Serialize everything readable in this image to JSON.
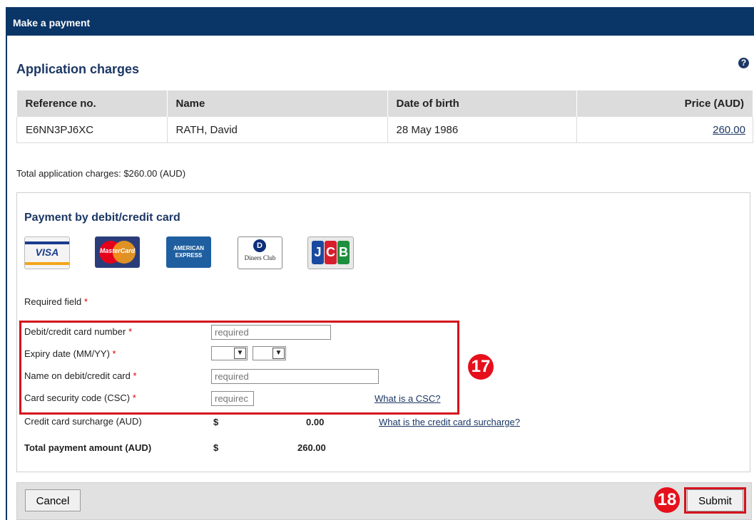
{
  "header": {
    "title": "Make a payment"
  },
  "charges": {
    "title": "Application charges",
    "help_icon": "?",
    "columns": [
      "Reference no.",
      "Name",
      "Date of birth",
      "Price (AUD)"
    ],
    "rows": [
      {
        "reference": "E6NN3PJ6XC",
        "name": "RATH, David",
        "dob": "28 May 1986",
        "price": "260.00"
      }
    ],
    "total_text": "Total application charges: $260.00 (AUD)"
  },
  "payment": {
    "title": "Payment by debit/credit card",
    "cards": {
      "visa": "VISA",
      "mastercard": "MasterCard",
      "amex_line1": "AMERICAN",
      "amex_line2": "EXPRESS",
      "diners": "Diners Club",
      "diners_letter": "D",
      "jcb": [
        "J",
        "C",
        "B"
      ]
    },
    "required_note": "Required field",
    "required_star": "*",
    "fields": {
      "card_number_label": "Debit/credit card number",
      "card_number_placeholder": "required",
      "expiry_label": "Expiry date (MM/YY)",
      "expiry_month": "",
      "expiry_year": "",
      "name_label": "Name on debit/credit card",
      "name_placeholder": "required",
      "csc_label": "Card security code (CSC)",
      "csc_placeholder": "requirec",
      "csc_link": "What is a CSC?"
    },
    "surcharge": {
      "label": "Credit card surcharge (AUD)",
      "currency": "$",
      "value": "0.00",
      "link": "What is the credit card surcharge?"
    },
    "total": {
      "label": "Total payment amount (AUD)",
      "currency": "$",
      "value": "260.00"
    },
    "step_markers": {
      "form": "17",
      "submit": "18"
    }
  },
  "actions": {
    "cancel": "Cancel",
    "submit": "Submit"
  },
  "colors": {
    "header_bg": "#0a3567",
    "accent_red": "#d4121c",
    "title_blue": "#1c3764"
  }
}
